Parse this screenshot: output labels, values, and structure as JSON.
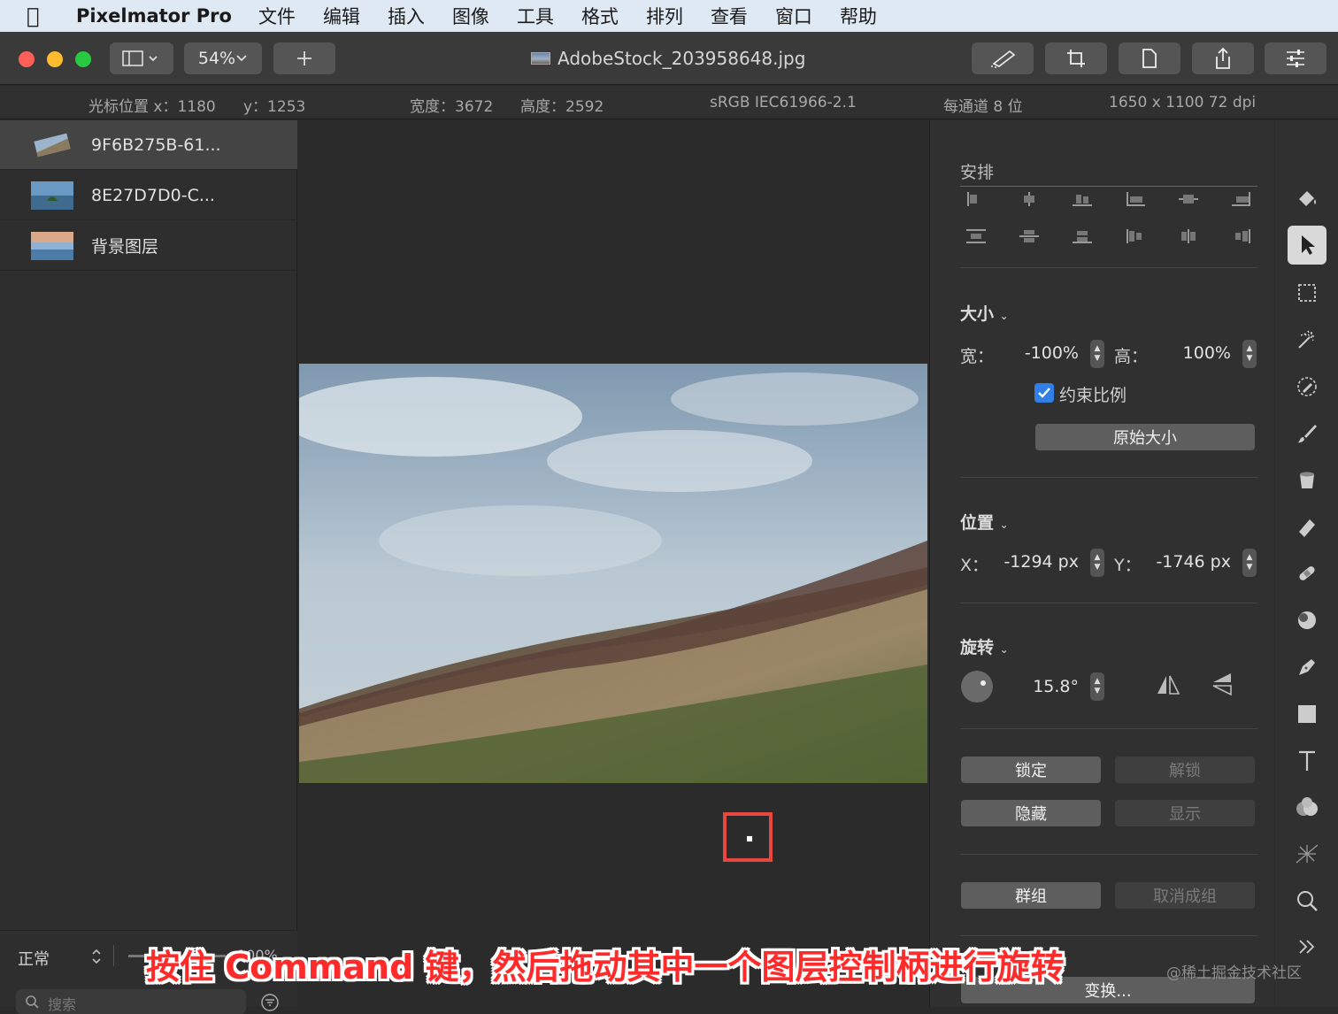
{
  "menubar": {
    "app_name": "Pixelmator Pro",
    "items": [
      "文件",
      "编辑",
      "插入",
      "图像",
      "工具",
      "格式",
      "排列",
      "查看",
      "窗口",
      "帮助"
    ]
  },
  "toolbar": {
    "zoom": "54%",
    "doc_title": "AdobeStock_203958648.jpg"
  },
  "info": {
    "cursor_x": "光标位置 x：1180",
    "cursor_y": "y：1253",
    "width": "宽度：3672",
    "height": "高度：2592",
    "color_profile": "sRGB IEC61966-2.1",
    "bit_depth": "每通道 8 位",
    "resolution": "1650 x 1100 72 dpi"
  },
  "layers": {
    "items": [
      {
        "name": "9F6B275B-61..."
      },
      {
        "name": "8E27D7D0-C..."
      },
      {
        "name": "背景图层"
      }
    ],
    "blend_mode": "正常",
    "opacity": "100%",
    "search_placeholder": "搜索"
  },
  "inspector": {
    "arrange_title": "安排",
    "size_title": "大小",
    "width_label": "宽：",
    "width_value": "-100%",
    "height_label": "高：",
    "height_value": "100%",
    "constrain_label": "约束比例",
    "constrain_checked": true,
    "original_size_label": "原始大小",
    "position_title": "位置",
    "x_label": "X：",
    "x_value": "-1294 px",
    "y_label": "Y：",
    "y_value": "-1746 px",
    "rotate_title": "旋转",
    "rotate_value": "15.8°",
    "lock_label": "锁定",
    "unlock_label": "解锁",
    "hide_label": "隐藏",
    "show_label": "显示",
    "group_label": "群组",
    "ungroup_label": "取消成组",
    "transform_label": "变换..."
  },
  "caption": "按住 Command 键，然后拖动其中一个图层控制柄进行旋转",
  "watermark": "@稀土掘金技术社区",
  "colors": {
    "accent_red": "#e8473f",
    "checkbox_blue": "#2f7fe6",
    "menubar_bg": "#dfe9f3"
  }
}
